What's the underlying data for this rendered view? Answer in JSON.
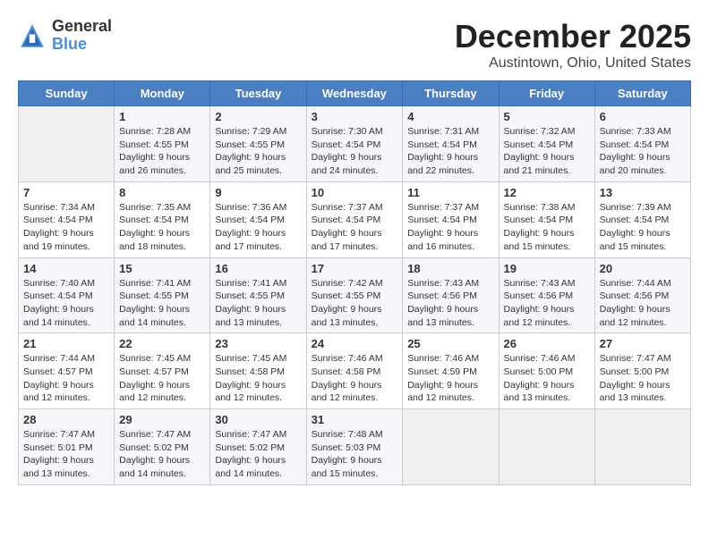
{
  "header": {
    "logo_general": "General",
    "logo_blue": "Blue",
    "month": "December 2025",
    "location": "Austintown, Ohio, United States"
  },
  "weekdays": [
    "Sunday",
    "Monday",
    "Tuesday",
    "Wednesday",
    "Thursday",
    "Friday",
    "Saturday"
  ],
  "weeks": [
    [
      {
        "day": "",
        "content": ""
      },
      {
        "day": "1",
        "content": "Sunrise: 7:28 AM\nSunset: 4:55 PM\nDaylight: 9 hours\nand 26 minutes."
      },
      {
        "day": "2",
        "content": "Sunrise: 7:29 AM\nSunset: 4:55 PM\nDaylight: 9 hours\nand 25 minutes."
      },
      {
        "day": "3",
        "content": "Sunrise: 7:30 AM\nSunset: 4:54 PM\nDaylight: 9 hours\nand 24 minutes."
      },
      {
        "day": "4",
        "content": "Sunrise: 7:31 AM\nSunset: 4:54 PM\nDaylight: 9 hours\nand 22 minutes."
      },
      {
        "day": "5",
        "content": "Sunrise: 7:32 AM\nSunset: 4:54 PM\nDaylight: 9 hours\nand 21 minutes."
      },
      {
        "day": "6",
        "content": "Sunrise: 7:33 AM\nSunset: 4:54 PM\nDaylight: 9 hours\nand 20 minutes."
      }
    ],
    [
      {
        "day": "7",
        "content": "Sunrise: 7:34 AM\nSunset: 4:54 PM\nDaylight: 9 hours\nand 19 minutes."
      },
      {
        "day": "8",
        "content": "Sunrise: 7:35 AM\nSunset: 4:54 PM\nDaylight: 9 hours\nand 18 minutes."
      },
      {
        "day": "9",
        "content": "Sunrise: 7:36 AM\nSunset: 4:54 PM\nDaylight: 9 hours\nand 17 minutes."
      },
      {
        "day": "10",
        "content": "Sunrise: 7:37 AM\nSunset: 4:54 PM\nDaylight: 9 hours\nand 17 minutes."
      },
      {
        "day": "11",
        "content": "Sunrise: 7:37 AM\nSunset: 4:54 PM\nDaylight: 9 hours\nand 16 minutes."
      },
      {
        "day": "12",
        "content": "Sunrise: 7:38 AM\nSunset: 4:54 PM\nDaylight: 9 hours\nand 15 minutes."
      },
      {
        "day": "13",
        "content": "Sunrise: 7:39 AM\nSunset: 4:54 PM\nDaylight: 9 hours\nand 15 minutes."
      }
    ],
    [
      {
        "day": "14",
        "content": "Sunrise: 7:40 AM\nSunset: 4:54 PM\nDaylight: 9 hours\nand 14 minutes."
      },
      {
        "day": "15",
        "content": "Sunrise: 7:41 AM\nSunset: 4:55 PM\nDaylight: 9 hours\nand 14 minutes."
      },
      {
        "day": "16",
        "content": "Sunrise: 7:41 AM\nSunset: 4:55 PM\nDaylight: 9 hours\nand 13 minutes."
      },
      {
        "day": "17",
        "content": "Sunrise: 7:42 AM\nSunset: 4:55 PM\nDaylight: 9 hours\nand 13 minutes."
      },
      {
        "day": "18",
        "content": "Sunrise: 7:43 AM\nSunset: 4:56 PM\nDaylight: 9 hours\nand 13 minutes."
      },
      {
        "day": "19",
        "content": "Sunrise: 7:43 AM\nSunset: 4:56 PM\nDaylight: 9 hours\nand 12 minutes."
      },
      {
        "day": "20",
        "content": "Sunrise: 7:44 AM\nSunset: 4:56 PM\nDaylight: 9 hours\nand 12 minutes."
      }
    ],
    [
      {
        "day": "21",
        "content": "Sunrise: 7:44 AM\nSunset: 4:57 PM\nDaylight: 9 hours\nand 12 minutes."
      },
      {
        "day": "22",
        "content": "Sunrise: 7:45 AM\nSunset: 4:57 PM\nDaylight: 9 hours\nand 12 minutes."
      },
      {
        "day": "23",
        "content": "Sunrise: 7:45 AM\nSunset: 4:58 PM\nDaylight: 9 hours\nand 12 minutes."
      },
      {
        "day": "24",
        "content": "Sunrise: 7:46 AM\nSunset: 4:58 PM\nDaylight: 9 hours\nand 12 minutes."
      },
      {
        "day": "25",
        "content": "Sunrise: 7:46 AM\nSunset: 4:59 PM\nDaylight: 9 hours\nand 12 minutes."
      },
      {
        "day": "26",
        "content": "Sunrise: 7:46 AM\nSunset: 5:00 PM\nDaylight: 9 hours\nand 13 minutes."
      },
      {
        "day": "27",
        "content": "Sunrise: 7:47 AM\nSunset: 5:00 PM\nDaylight: 9 hours\nand 13 minutes."
      }
    ],
    [
      {
        "day": "28",
        "content": "Sunrise: 7:47 AM\nSunset: 5:01 PM\nDaylight: 9 hours\nand 13 minutes."
      },
      {
        "day": "29",
        "content": "Sunrise: 7:47 AM\nSunset: 5:02 PM\nDaylight: 9 hours\nand 14 minutes."
      },
      {
        "day": "30",
        "content": "Sunrise: 7:47 AM\nSunset: 5:02 PM\nDaylight: 9 hours\nand 14 minutes."
      },
      {
        "day": "31",
        "content": "Sunrise: 7:48 AM\nSunset: 5:03 PM\nDaylight: 9 hours\nand 15 minutes."
      },
      {
        "day": "",
        "content": ""
      },
      {
        "day": "",
        "content": ""
      },
      {
        "day": "",
        "content": ""
      }
    ]
  ]
}
